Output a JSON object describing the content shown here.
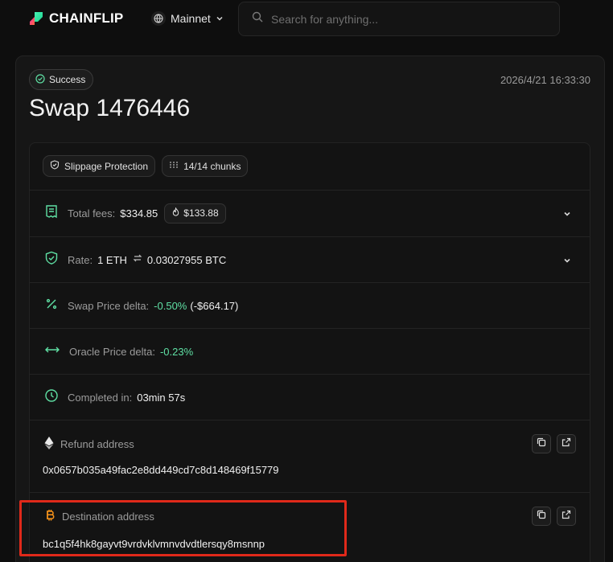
{
  "nav": {
    "brand": "CHAINFLIP",
    "network": "Mainnet",
    "search_placeholder": "Search for anything..."
  },
  "swap": {
    "status": "Success",
    "timestamp": "2026/4/21 16:33:30",
    "title": "Swap 1476446",
    "chips": {
      "slippage": "Slippage Protection",
      "chunks": "14/14 chunks"
    },
    "fees": {
      "label": "Total fees:",
      "value": "$334.85",
      "burn": "$133.88"
    },
    "rate": {
      "label": "Rate:",
      "from": "1 ETH",
      "to": "0.03027955 BTC"
    },
    "swap_delta": {
      "label": "Swap Price delta:",
      "percent": "-0.50%",
      "usd": "(-$664.17)"
    },
    "oracle_delta": {
      "label": "Oracle Price delta:",
      "percent": "-0.23%"
    },
    "completed": {
      "label": "Completed in:",
      "value": "03min 57s"
    },
    "refund": {
      "label": "Refund address",
      "value": "0x0657b035a49fac2e8dd449cd7c8d148469f15779"
    },
    "destination": {
      "label": "Destination address",
      "value": "bc1q5f4hk8gayvt9vrdvklvmnvdvdtlersqy8msnnp"
    }
  },
  "colors": {
    "accent_green": "#5fe0a4",
    "bitcoin_orange": "#f7931a",
    "highlight_red": "#e0291a"
  }
}
